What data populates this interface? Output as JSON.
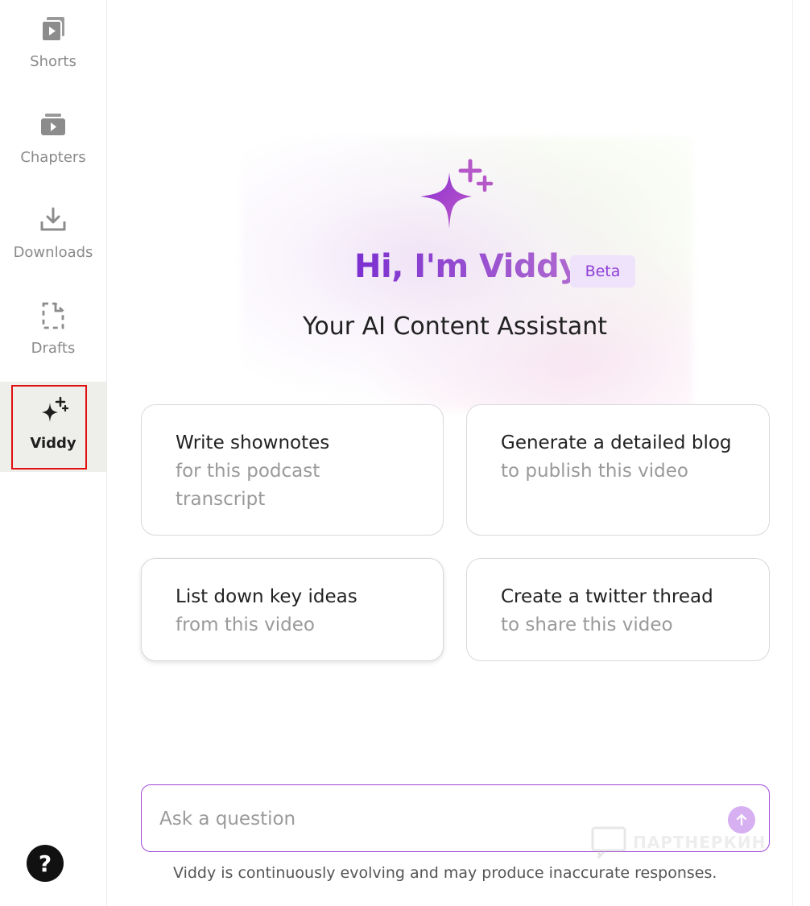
{
  "sidebar": {
    "items": [
      {
        "label": "Shorts",
        "icon": "play-square-icon"
      },
      {
        "label": "Chapters",
        "icon": "play-stack-icon"
      },
      {
        "label": "Downloads",
        "icon": "download-icon"
      },
      {
        "label": "Drafts",
        "icon": "draft-icon"
      },
      {
        "label": "Viddy",
        "icon": "sparkle-icon",
        "active": true
      }
    ],
    "help_label": "?"
  },
  "hero": {
    "title": "Hi, I'm Viddy",
    "badge": "Beta",
    "subtitle": "Your AI Content Assistant"
  },
  "suggestions": [
    {
      "title": "Write shownotes",
      "detail": "for this podcast transcript"
    },
    {
      "title": "Generate a detailed blog",
      "detail": "to publish this video"
    },
    {
      "title": "List down key ideas",
      "detail": "from this video"
    },
    {
      "title": "Create a twitter thread",
      "detail": "to share this video"
    }
  ],
  "ask": {
    "placeholder": "Ask a question",
    "value": ""
  },
  "disclaimer": "Viddy is continuously evolving and may produce inaccurate responses.",
  "watermark": "ПАРТНЕРКИН",
  "colors": {
    "accent": "#a149d8",
    "badge_bg": "#efe2fb",
    "active_outline": "#e01010"
  }
}
